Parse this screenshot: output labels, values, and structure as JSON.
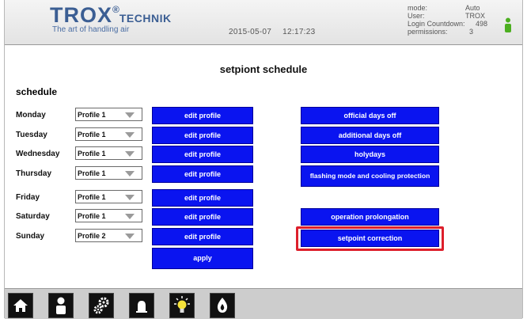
{
  "header": {
    "logo_main": "TROX",
    "logo_reg": "®",
    "logo_technik": "TECHNIK",
    "logo_sub": "The art of handling air",
    "date": "2015-05-07",
    "time": "12:17:23",
    "info": [
      {
        "key": "mode:",
        "value": "Auto"
      },
      {
        "key": "User:",
        "value": "TROX"
      },
      {
        "key": "Login Countdown:",
        "value": "498"
      },
      {
        "key": "permissions:",
        "value": "3"
      }
    ]
  },
  "page": {
    "title": "setpiont schedule",
    "section": "schedule"
  },
  "schedule": [
    {
      "day": "Monday",
      "profile": "Profile 1",
      "action": "edit profile"
    },
    {
      "day": "Tuesday",
      "profile": "Profile 1",
      "action": "edit profile"
    },
    {
      "day": "Wednesday",
      "profile": "Profile 1",
      "action": "edit profile"
    },
    {
      "day": "Thursday",
      "profile": "Profile 1",
      "action": "edit profile"
    },
    {
      "day": "Friday",
      "profile": "Profile 1",
      "action": "edit profile"
    },
    {
      "day": "Saturday",
      "profile": "Profile 1",
      "action": "edit profile"
    },
    {
      "day": "Sunday",
      "profile": "Profile 2",
      "action": "edit profile"
    }
  ],
  "apply_label": "apply",
  "options": {
    "official_days_off": "official days off",
    "additional_days_off": "additional days off",
    "holydays": "holydays",
    "flashing_mode": "flashing mode and cooling protection",
    "operation_prolongation": "operation prolongation",
    "setpoint_correction": "setpoint correction"
  },
  "colors": {
    "button": "#0a14f0",
    "highlight": "#dd1f2b",
    "logo": "#3b5e93",
    "user_icon": "#4caf20"
  },
  "footer": {
    "icons": [
      "home-icon",
      "user-icon",
      "settings-gears-icon",
      "alarm-bell-icon",
      "light-bulb-icon",
      "flame-icon"
    ]
  }
}
